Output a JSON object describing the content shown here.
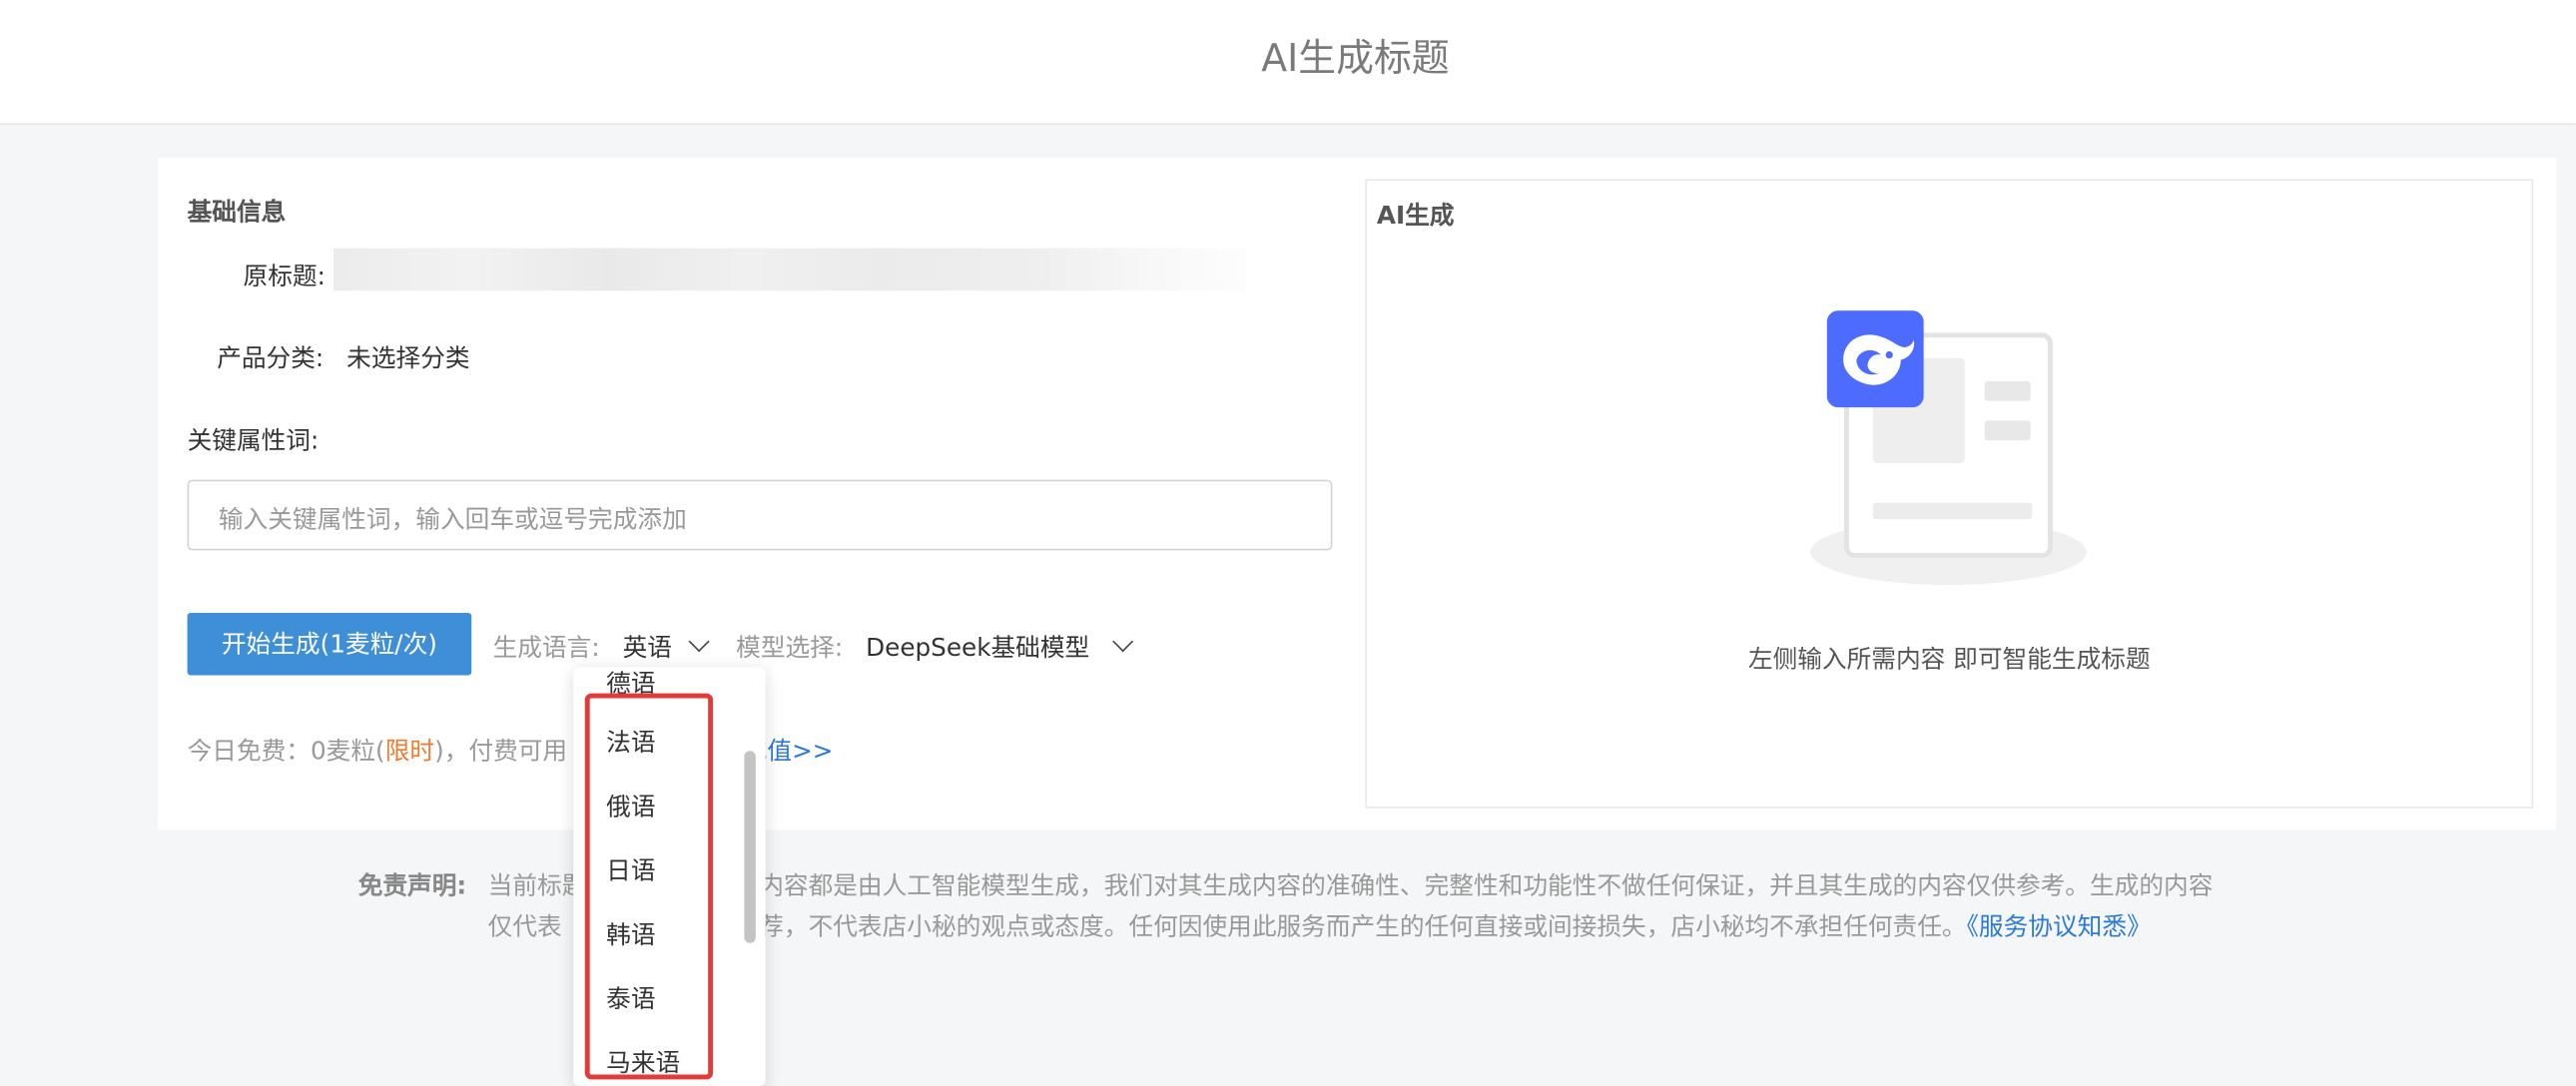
{
  "header": {
    "title": "AI生成标题"
  },
  "basic_info": {
    "section_title": "基础信息",
    "original_title_label": "原标题:",
    "category_label": "产品分类:",
    "category_value": "未选择分类",
    "keywords_label": "关键属性词:",
    "keywords_placeholder": "输入关键属性词，输入回车或逗号完成添加"
  },
  "actions": {
    "generate_button": "开始生成(1麦粒/次)",
    "language_label": "生成语言:",
    "language_value": "英语",
    "model_label": "模型选择:",
    "model_value": "DeepSeek基础模型"
  },
  "quota": {
    "free_prefix": "今日免费：0麦粒(",
    "limited": "限时",
    "paid_prefix": ")，付费可用",
    "recharge_link": "充值>>"
  },
  "language_dropdown": {
    "partial_top": "德语",
    "options": [
      "法语",
      "俄语",
      "日语",
      "韩语",
      "泰语",
      "马来语"
    ]
  },
  "ai_panel": {
    "title": "AI生成",
    "empty_text": "左侧输入所需内容 即可智能生成标题",
    "logo_icon": "deepseek-whale-icon",
    "brand_color": "#4d6bfe"
  },
  "disclaimer": {
    "label": "免责声明:",
    "line1_a": "当前标题",
    "line1_b": "的所有内容都是由人工智能模型生成，我们对其生成内容的准确性、完整性和功能性不做任何保证，并且其生成的内容仅供参考。生成的内容",
    "line2_a": "仅代表",
    "line2_b": "预测和推荐，不代表店小秘的观点或态度。任何因使用此服务而产生的任何直接或间接损失，店小秘均不承担任何责任。",
    "link": "《服务协议知悉》"
  },
  "colors": {
    "primary": "#3f8fd8",
    "accent": "#f07b2f",
    "link": "#2b7ad6",
    "highlight": "#e23b3b"
  }
}
